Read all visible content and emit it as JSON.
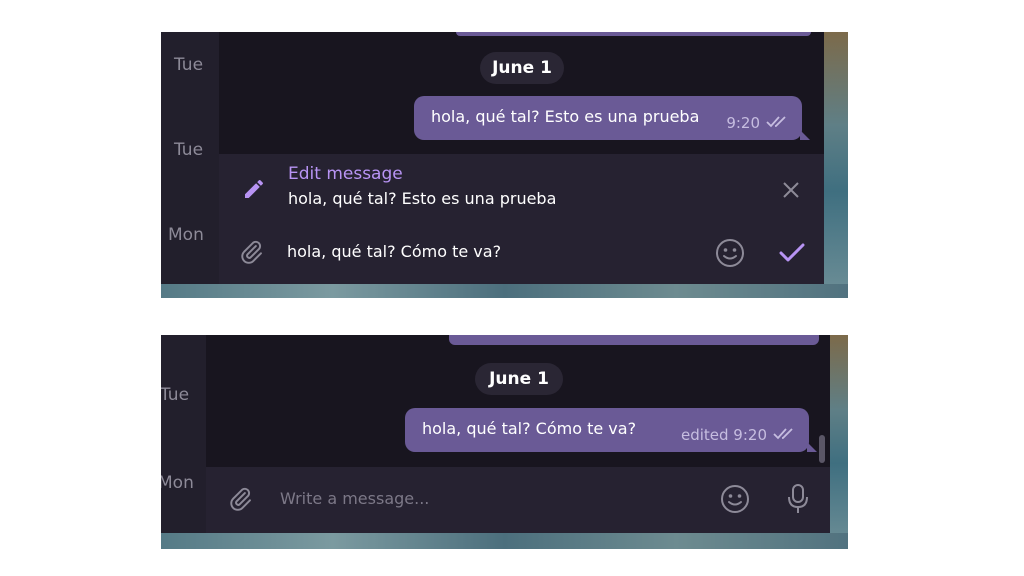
{
  "top_panel": {
    "sidebar_days": [
      "Tue",
      "Tue",
      "Mon"
    ],
    "date_separator": "June 1",
    "message": {
      "text": "hola, qué tal? Esto es una prueba",
      "time": "9:20",
      "status_icon": "double-check-icon"
    },
    "edit_bar": {
      "title": "Edit message",
      "preview": "hola, qué tal? Esto es una prueba",
      "icon": "pencil-icon",
      "close_icon": "close-icon"
    },
    "composer": {
      "value": "hola, qué tal?  Cómo te va?",
      "attach_icon": "paperclip-icon",
      "emoji_icon": "smiley-icon",
      "send_icon": "checkmark-icon"
    }
  },
  "bottom_panel": {
    "sidebar_days": [
      "Tue",
      "Mon"
    ],
    "date_separator": "June 1",
    "message": {
      "text": "hola, qué tal?  Cómo te va?",
      "time": "edited 9:20",
      "status_icon": "double-check-icon"
    },
    "composer": {
      "placeholder": "Write a message...",
      "attach_icon": "paperclip-icon",
      "emoji_icon": "smiley-icon",
      "mic_icon": "microphone-icon"
    }
  },
  "colors": {
    "accent": "#b894f4",
    "bubble": "#6a5a96",
    "chat_bg": "#18151f",
    "panel_bg": "#262231"
  }
}
